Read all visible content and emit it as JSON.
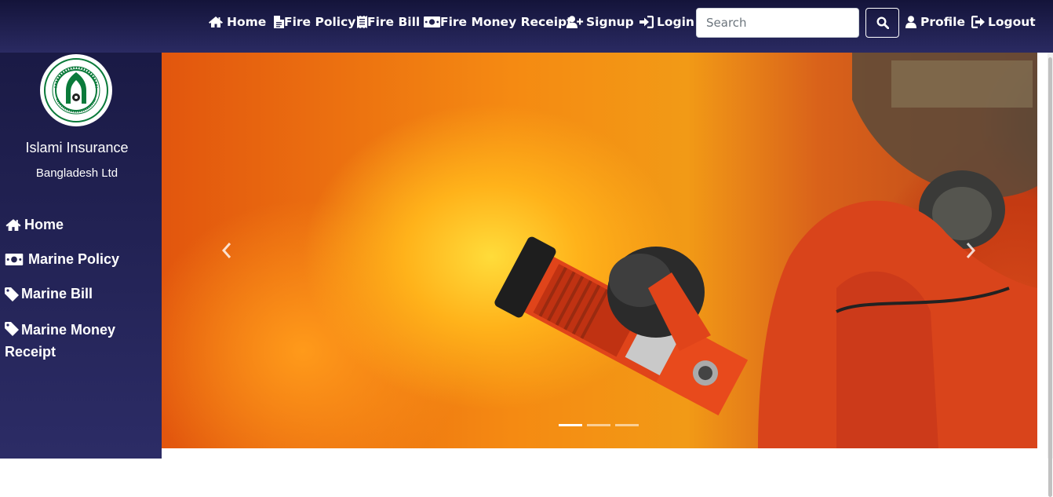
{
  "nav": {
    "home": "Home",
    "fire_policy": "Fire Policy",
    "fire_bill": "Fire Bill",
    "fire_money_receipt": "Fire Money Receipt",
    "signup": "Signup",
    "login": "Login",
    "search_placeholder": "Search",
    "profile": "Profile",
    "logout": "Logout"
  },
  "sidebar": {
    "brand_line1": "Islami Insurance",
    "brand_line2": "Bangladesh Ltd",
    "items": [
      {
        "label": "Home",
        "icon": "home-icon"
      },
      {
        "label": "Marine Policy",
        "icon": "money-bill-icon"
      },
      {
        "label": "Marine Bill",
        "icon": "tag-icon"
      },
      {
        "label": "Marine Money Receipt",
        "icon": "tag-icon"
      }
    ]
  },
  "carousel": {
    "slide_count": 3,
    "active_slide": 1,
    "image": "firefighter with hose nozzle in front of flames"
  },
  "colors": {
    "navbar": "#1e1e4e",
    "sidebar": "#222257",
    "logo_green": "#0a7a3a"
  }
}
